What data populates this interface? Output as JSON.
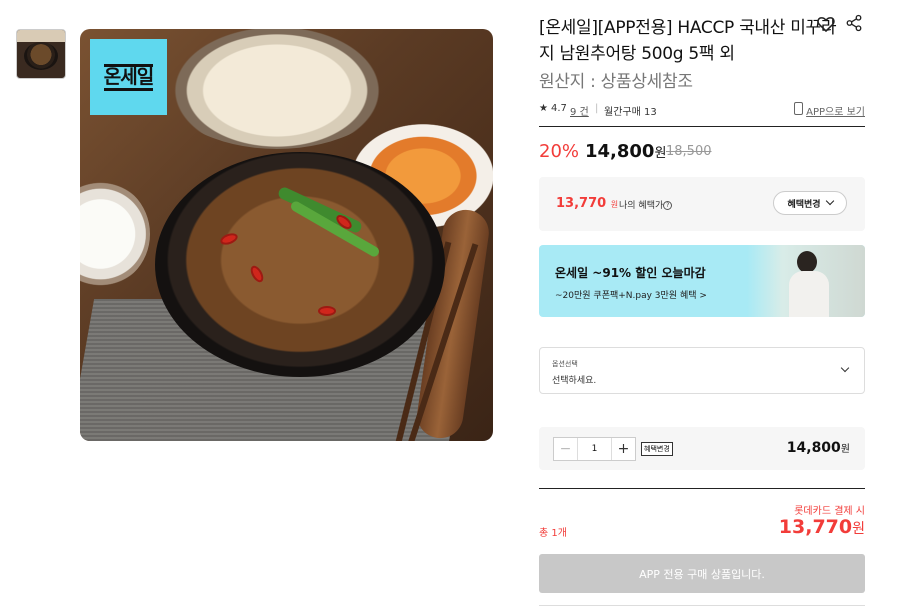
{
  "product": {
    "title": "[온세일][APP전용] HACCP 국내산 미꾸라지 남원추어탕 500g 5팩 외",
    "origin": "원산지 : 상품상세참조",
    "image_badge": "온세일"
  },
  "rating": {
    "star": "★",
    "score": "4.7",
    "reviews": "9 건",
    "separator": "|",
    "monthly": "월간구매 13",
    "app_view": "APP으로 보기"
  },
  "price": {
    "discount": "20%",
    "sale": "14,800",
    "won": "원",
    "original": "18,500"
  },
  "benefit": {
    "price": "13,770",
    "unit": "원",
    "label": "나의 혜택가",
    "info": "?",
    "button": "혜택변경"
  },
  "banner": {
    "title": "온세일 ~91% 할인 오늘마감",
    "subtitle": "~20만원 쿠폰팩+N.pay 3만원 혜택 >"
  },
  "option": {
    "label": "옵션선택",
    "value": "선택하세요."
  },
  "quantity": {
    "minus": "−",
    "value": "1",
    "plus": "+",
    "benefit_tag": "혜택변경",
    "price": "14,800",
    "won": "원"
  },
  "total": {
    "card_label": "롯데카드 결제 시",
    "count": "총 1개",
    "price": "13,770",
    "won": "원"
  },
  "buy_button": "APP 전용 구매 상품입니다.",
  "colors": {
    "accent_red": "#f23c39",
    "banner_bg": "#a8eaf5",
    "badge_bg": "#5fd8ee",
    "disabled_btn": "#c8c8c8"
  }
}
